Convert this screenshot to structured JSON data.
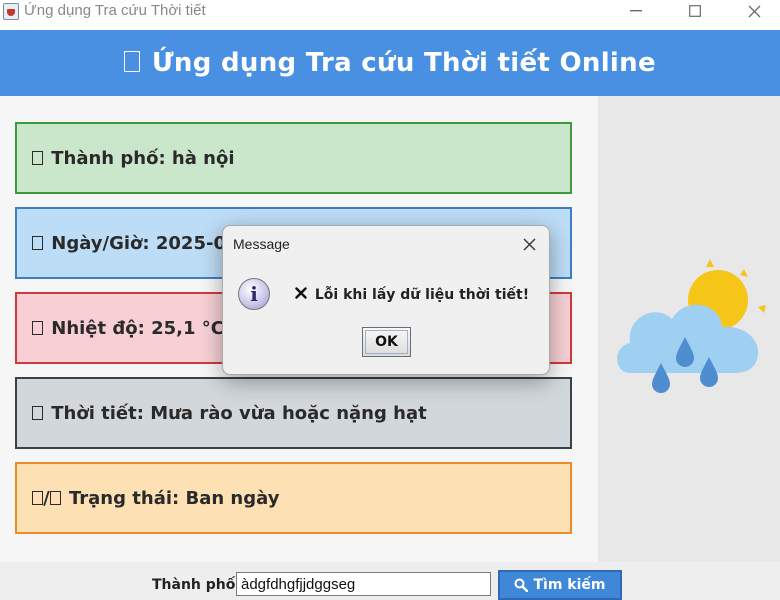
{
  "window": {
    "title": "Ứng dụng Tra cứu Thời tiết"
  },
  "header": {
    "title": "Ứng dụng Tra cứu Thời tiết Online"
  },
  "cards": {
    "city": "Thành phố: hà nội",
    "datetime": "Ngày/Giờ: 2025-09-",
    "temperature": "Nhiệt độ: 25,1 °C",
    "weather": "Thời tiết: Mưa rào vừa hoặc nặng hạt",
    "status_prefix": "/",
    "status": "Trạng thái: Ban ngày"
  },
  "search": {
    "label": "Thành phố:",
    "value": "àdgfdhgfjjdggseg",
    "button_label": "Tìm kiếm"
  },
  "dialog": {
    "title": "Message",
    "message": "Lỗi khi lấy dữ liệu thời tiết!",
    "info_glyph": "i",
    "ok_label": "OK"
  },
  "icons": {
    "app": "java-cup-icon",
    "info": "info-icon",
    "search": "search-icon",
    "weather": "sun-cloud-rain-icon",
    "error": "x-mark-icon"
  },
  "colors": {
    "header": "#4a90e2",
    "card_city": "#cbe7cb",
    "card_time": "#bddcf5",
    "card_temp": "#f7cfd4",
    "card_weather": "#d2d7dc",
    "card_status": "#fde0b4",
    "search_button": "#3f87d8"
  }
}
